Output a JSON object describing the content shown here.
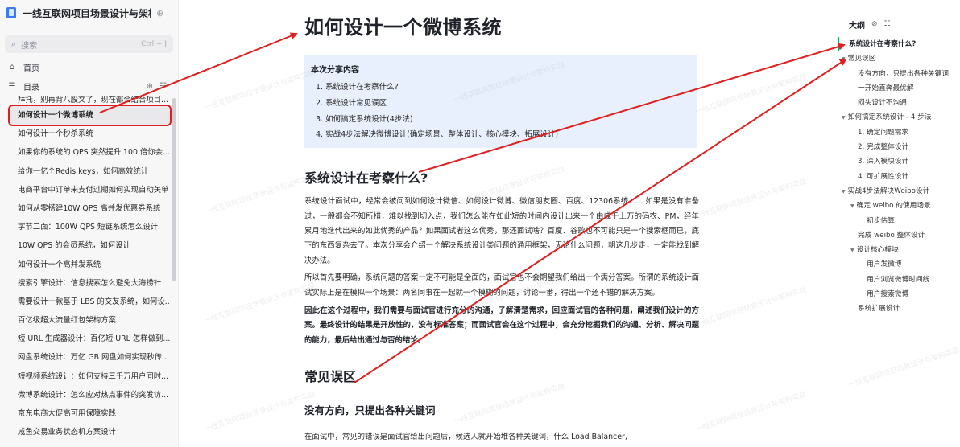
{
  "sidebar": {
    "book_title": "一线互联网项目场景设计与架构...",
    "search": {
      "placeholder": "搜索",
      "shortcut": "Ctrl + J"
    },
    "home_label": "首页",
    "catalog_label": "目录",
    "items": [
      "拜托，别再背八股文了，现在都会结合项目...",
      "如何设计一个微博系统",
      "如何设计一个秒杀系统",
      "如果你的系统的 QPS 突然提升 100 倍你会...",
      "给你一亿个Redis keys，如何高效统计",
      "电商平台中订单未支付过期如何实现自动关单",
      "如何从零搭建10W QPS 高并发优惠券系统",
      "字节二面：100W QPS 短链系统怎么设计",
      "10W QPS 的会员系统，如何设计",
      "如何设计一个高并发系统",
      "搜索引擎设计：信息搜索怎么避免大海捞针",
      "需要设计一款基于 LBS 的交友系统，如何设...",
      "百亿级超大流量红包架构方案",
      "短 URL 生成器设计：百亿短 URL 怎样做到...",
      "网盘系统设计：万亿 GB 网盘如何实现秒传...",
      "短视频系统设计：如何支持三千万用户同时...",
      "微博系统设计：怎么应对热点事件的突发访...",
      "京东电商大促高可用保障实践",
      "咸鱼交易业务状态机方案设计"
    ],
    "active_index": 1
  },
  "document": {
    "title": "如何设计一个微博系统",
    "callout": {
      "title": "本次分享内容",
      "items": [
        "1. 系统设计在考察什么?",
        "2. 系统设计常见误区",
        "3. 如何搞定系统设计(4步法)",
        "4. 实战4步法解决微博设计(确定场景、整体设计、核心模块、拓展设计)"
      ]
    },
    "section1_title": "系统设计在考察什么?",
    "para1": "系统设计面试中，经常会被问到如何设计微信、如何设计微博、微信朋友圈、百度、12306系统...... 如果是没有准备过，一般都会不知所措，难以找到切入点，我们怎么能在如此短的时间内设计出来一个由成千上万的码农、PM，经年累月地迭代出来的如此优秀的产品？如果面试者这么优秀，那还面试啥？百度、谷歌也不可能只是一个搜索框而已，底下的东西复杂去了。本次分享会介绍一个解决系统设计类问题的通用框架，无论什么问题，朝这几步走，一定能找到解决办法。",
    "para2": "所以首先要明确，系统问题的答案一定不可能是全面的，面试官也不会期望我们给出一个满分答案。所谓的系统设计面试实际上是在模拟一个场景：两名同事在一起就一个模糊的问题，讨论一番，得出一个还不错的解决方案。",
    "para3": "因此在这个过程中，我们需要与面试官进行充分的沟通，了解清楚需求，回应面试官的各种问题，阐述我们设计的方案。最终设计的结果是开放性的，没有标准答案；而面试官会在这个过程中，会充分挖掘我们的沟通、分析、解决问题的能力，最后给出通过与否的结论。",
    "section2_title": "常见误区",
    "subsection_title": "没有方向，只提出各种关键词",
    "para4": "在面试中，常见的错误是面试官给出问题后，候选人就开始堆各种关键词，什么 Load Balancer,"
  },
  "outline": {
    "title": "大纲",
    "items": [
      {
        "level": 1,
        "text": "系统设计在考察什么?",
        "current": true,
        "toggle": false
      },
      {
        "level": 1,
        "text": "常见误区",
        "current": false,
        "toggle": true
      },
      {
        "level": 3,
        "text": "没有方向，只提出各种关键词",
        "current": false,
        "toggle": false
      },
      {
        "level": 3,
        "text": "一开始直奔最优解",
        "current": false,
        "toggle": false
      },
      {
        "level": 3,
        "text": "闷头设计不沟通",
        "current": false,
        "toggle": false
      },
      {
        "level": 1,
        "text": "如何搞定系统设计 - 4 步法",
        "current": false,
        "toggle": true
      },
      {
        "level": 3,
        "text": "1. 确定问题需求",
        "current": false,
        "toggle": false
      },
      {
        "level": 3,
        "text": "2. 完成整体设计",
        "current": false,
        "toggle": false
      },
      {
        "level": 3,
        "text": "3. 深入模块设计",
        "current": false,
        "toggle": false
      },
      {
        "level": 3,
        "text": "4. 可扩展性设计",
        "current": false,
        "toggle": false
      },
      {
        "level": 1,
        "text": "实战4步法解决Weibo设计",
        "current": false,
        "toggle": true
      },
      {
        "level": 2,
        "text": "确定 weibo 的使用场景",
        "current": false,
        "toggle": true
      },
      {
        "level": 4,
        "text": "初步估算",
        "current": false,
        "toggle": false
      },
      {
        "level": 3,
        "text": "完成 weibo 整体设计",
        "current": false,
        "toggle": false
      },
      {
        "level": 2,
        "text": "设计核心模块",
        "current": false,
        "toggle": true
      },
      {
        "level": 4,
        "text": "用户发微博",
        "current": false,
        "toggle": false
      },
      {
        "level": 4,
        "text": "用户浏览微博时间线",
        "current": false,
        "toggle": false
      },
      {
        "level": 4,
        "text": "用户搜索微博",
        "current": false,
        "toggle": false
      },
      {
        "level": 3,
        "text": "系统扩展设计",
        "current": false,
        "toggle": false
      }
    ]
  },
  "watermark": "一线互联网项目场景设计与架构实战",
  "colors": {
    "annotation_red": "#e02020",
    "outline_active": "#1fa864",
    "callout_bg": "#e8f0fd"
  }
}
